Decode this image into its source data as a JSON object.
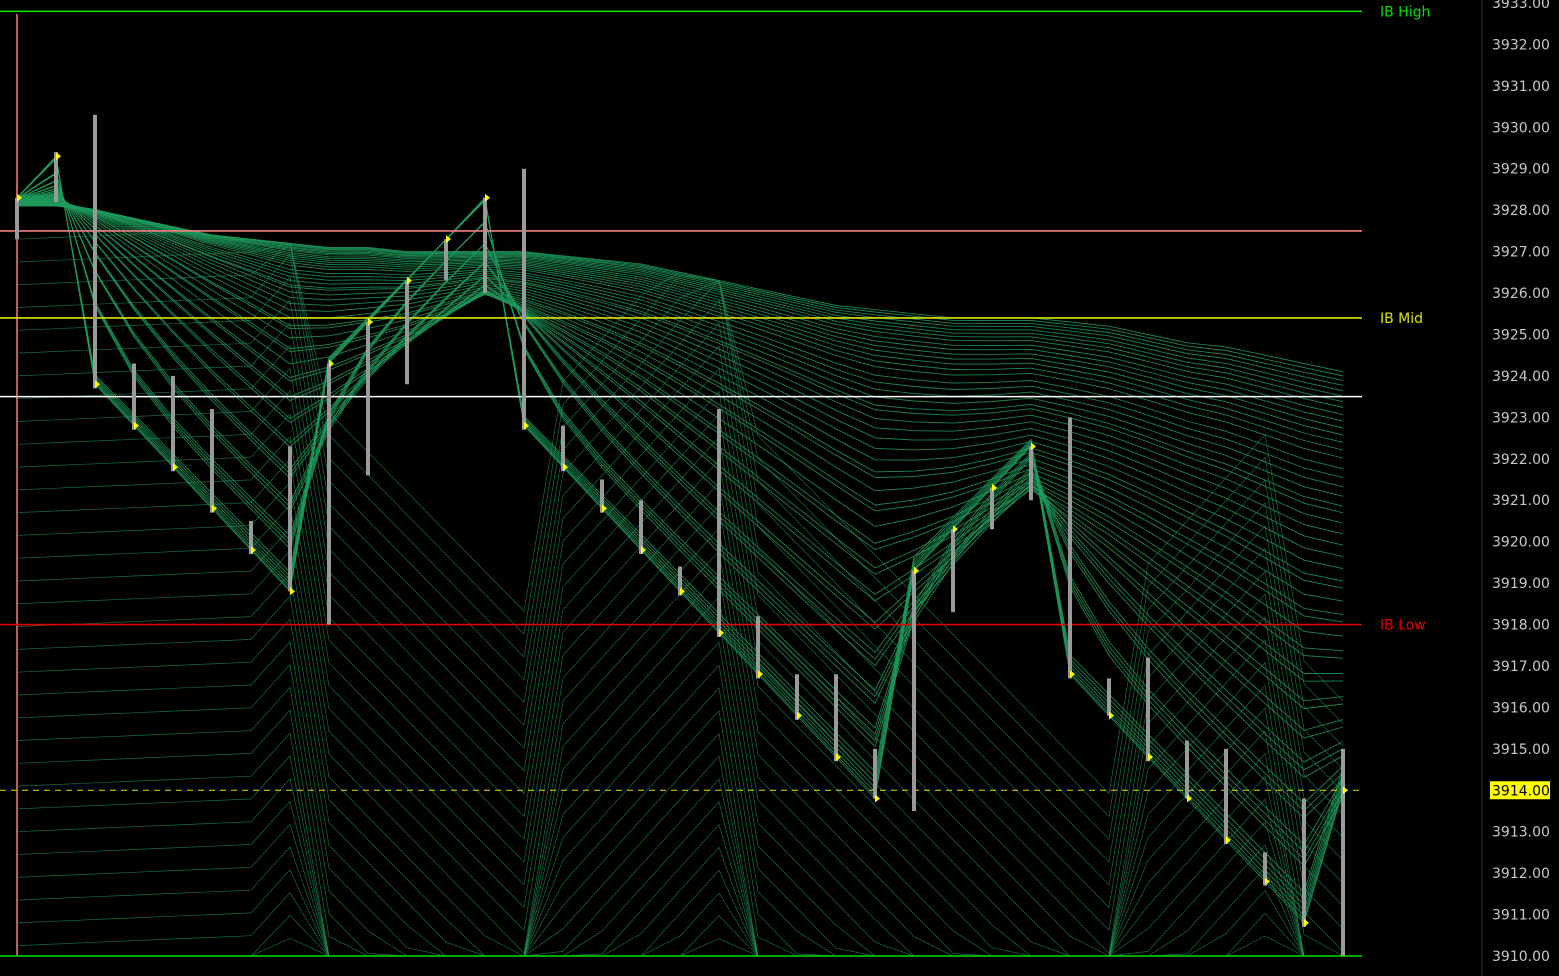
{
  "chart_data": {
    "type": "ohlc",
    "ylim": [
      3910,
      3933
    ],
    "y_ticks": [
      "3933.00",
      "3932.00",
      "3931.00",
      "3930.00",
      "3929.00",
      "3928.00",
      "3927.00",
      "3926.00",
      "3925.00",
      "3924.00",
      "3923.00",
      "3922.00",
      "3921.00",
      "3920.00",
      "3919.00",
      "3918.00",
      "3917.00",
      "3916.00",
      "3915.00",
      "3914.00",
      "3913.00",
      "3912.00",
      "3911.00",
      "3910.00"
    ],
    "last_price_label": "3914.00",
    "last_price": 3914.0,
    "reference_lines": [
      {
        "label": "IB High",
        "value": 3932.8,
        "color": "#00e000"
      },
      {
        "label": "",
        "value": 3927.5,
        "color": "#f08080"
      },
      {
        "label": "IB Mid",
        "value": 3925.4,
        "color": "#e0e000"
      },
      {
        "label": "",
        "value": 3923.5,
        "color": "#ffffff"
      },
      {
        "label": "IB Low",
        "value": 3918.0,
        "color": "#e00000"
      },
      {
        "label": "",
        "value": 3910.0,
        "color": "#00e000"
      }
    ],
    "bars": [
      {
        "high": 3928.3,
        "low": 3927.3,
        "close": 3928.3
      },
      {
        "high": 3929.4,
        "low": 3928.2,
        "close": 3929.3
      },
      {
        "high": 3930.3,
        "low": 3923.7,
        "close": 3923.8
      },
      {
        "high": 3924.3,
        "low": 3922.7,
        "close": 3922.8
      },
      {
        "high": 3924.0,
        "low": 3921.7,
        "close": 3921.8
      },
      {
        "high": 3923.2,
        "low": 3920.7,
        "close": 3920.8
      },
      {
        "high": 3920.5,
        "low": 3919.7,
        "close": 3919.8
      },
      {
        "high": 3922.3,
        "low": 3918.8,
        "close": 3918.8
      },
      {
        "high": 3924.3,
        "low": 3918.0,
        "close": 3924.3
      },
      {
        "high": 3925.3,
        "low": 3921.6,
        "close": 3925.3
      },
      {
        "high": 3926.3,
        "low": 3923.8,
        "close": 3926.3
      },
      {
        "high": 3927.3,
        "low": 3926.3,
        "close": 3927.3
      },
      {
        "high": 3928.3,
        "low": 3926.0,
        "close": 3928.3
      },
      {
        "high": 3929.0,
        "low": 3922.7,
        "close": 3922.8
      },
      {
        "high": 3922.8,
        "low": 3921.7,
        "close": 3921.8
      },
      {
        "high": 3921.5,
        "low": 3920.7,
        "close": 3920.8
      },
      {
        "high": 3921.0,
        "low": 3919.7,
        "close": 3919.8
      },
      {
        "high": 3919.4,
        "low": 3918.7,
        "close": 3918.8
      },
      {
        "high": 3923.2,
        "low": 3917.7,
        "close": 3917.8
      },
      {
        "high": 3918.2,
        "low": 3916.7,
        "close": 3916.8
      },
      {
        "high": 3916.8,
        "low": 3915.7,
        "close": 3915.8
      },
      {
        "high": 3916.8,
        "low": 3914.7,
        "close": 3914.8
      },
      {
        "high": 3915.0,
        "low": 3913.8,
        "close": 3913.8
      },
      {
        "high": 3919.3,
        "low": 3913.5,
        "close": 3919.3
      },
      {
        "high": 3920.3,
        "low": 3918.3,
        "close": 3920.3
      },
      {
        "high": 3921.3,
        "low": 3920.3,
        "close": 3921.3
      },
      {
        "high": 3922.3,
        "low": 3921.0,
        "close": 3922.3
      },
      {
        "high": 3923.0,
        "low": 3916.7,
        "close": 3916.8
      },
      {
        "high": 3916.7,
        "low": 3915.8,
        "close": 3915.8
      },
      {
        "high": 3917.2,
        "low": 3914.7,
        "close": 3914.8
      },
      {
        "high": 3915.2,
        "low": 3913.8,
        "close": 3913.8
      },
      {
        "high": 3915.0,
        "low": 3912.7,
        "close": 3912.8
      },
      {
        "high": 3912.5,
        "low": 3911.7,
        "close": 3911.8
      },
      {
        "high": 3913.8,
        "low": 3910.7,
        "close": 3910.8
      },
      {
        "high": 3915.0,
        "low": 3910.0,
        "close": 3914.0
      }
    ],
    "moving_average_ribbon_upper": [
      3928.1,
      3928.1,
      3928.0,
      3927.8,
      3927.6,
      3927.4,
      3927.3,
      3927.2,
      3927.1,
      3927.1,
      3927.0,
      3927.0,
      3927.0,
      3927.0,
      3926.9,
      3926.8,
      3926.7,
      3926.5,
      3926.3,
      3926.1,
      3925.9,
      3925.7,
      3925.6,
      3925.5,
      3925.4,
      3925.4,
      3925.4,
      3925.3,
      3925.2,
      3925.0,
      3924.8,
      3924.7,
      3924.5,
      3924.3,
      3924.1
    ],
    "colors": {
      "background": "#000000",
      "bar": "#9a9a9a",
      "close_marker": "#ffff00",
      "ribbon": "#1f9a5c",
      "axis_text": "#c8c8c8",
      "last_price_bg": "#ffff00"
    }
  }
}
